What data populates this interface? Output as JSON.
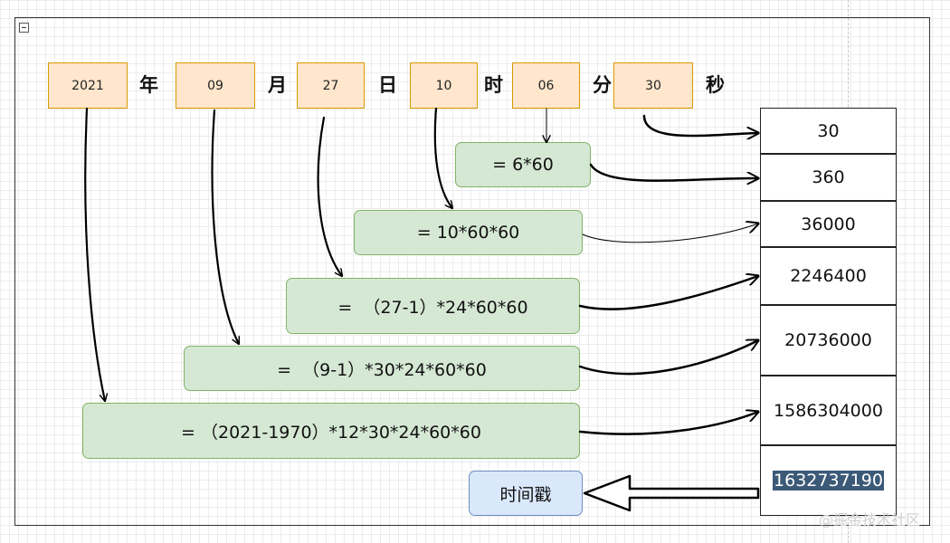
{
  "date_fields": [
    {
      "value": "2021",
      "unit": "年"
    },
    {
      "value": "09",
      "unit": "月"
    },
    {
      "value": "27",
      "unit": "日"
    },
    {
      "value": "10",
      "unit": "时"
    },
    {
      "value": "06",
      "unit": "分"
    },
    {
      "value": "30",
      "unit": "秒"
    }
  ],
  "formulas": [
    "= 6*60",
    "= 10*60*60",
    "=  （27-1）*24*60*60",
    "=  （9-1）*30*24*60*60",
    "= （2021-1970）*12*30*24*60*60"
  ],
  "results": [
    "30",
    "360",
    "36000",
    "2246400",
    "20736000",
    "1586304000"
  ],
  "timestamp_value": "1632737190",
  "timestamp_label": "时间戳",
  "watermark": "@掘金技术社区"
}
